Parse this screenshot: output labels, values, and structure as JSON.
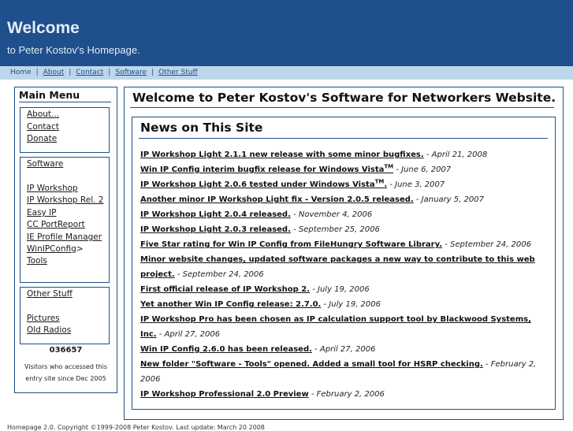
{
  "header": {
    "title": "Welcome",
    "subtitle": "to Peter Kostov's Homepage."
  },
  "nav": {
    "items": [
      "Home",
      "About",
      "Contact",
      "Software",
      "Other Stuff"
    ],
    "separator": "|"
  },
  "sidebar": {
    "title": "Main Menu",
    "group1": [
      "About...",
      "Contact",
      "Donate"
    ],
    "group2_header": "Software",
    "group2": [
      "IP Workshop",
      "IP Workshop Rel. 2",
      "Easy IP",
      "CC PortReport",
      "IE Profile Manager",
      "WinIPConfig",
      "Tools"
    ],
    "winipconfig_suffix": ">",
    "group3_header": "Other Stuff",
    "group3": [
      "Pictures",
      "Old Radios"
    ],
    "counter": "036657",
    "visitors_text": "Visitors who accessed this entry site since Dec 2005"
  },
  "main": {
    "title": "Welcome to Peter Kostov's Software for Networkers Website.",
    "news_title": "News on This Site",
    "tm": "TM",
    "news": [
      {
        "link": "IP Workshop Light 2.1.1 new release with some minor bugfixes.",
        "date": "April 21, 2008"
      },
      {
        "link": "Win IP Config interim bugfix release for Windows Vista",
        "tm": true,
        "date": "June 6, 2007"
      },
      {
        "link": "IP Workshop Light 2.0.6 tested under Windows Vista",
        "tm": true,
        "suffix": ".",
        "date": "June 3, 2007"
      },
      {
        "link": "Another minor IP Workshop Light fix - Version 2.0.5 released.",
        "date": "January 5, 2007"
      },
      {
        "link": "IP Workshop Light 2.0.4 released.",
        "date": "November 4, 2006"
      },
      {
        "link": "IP Workshop Light 2.0.3 released.",
        "date": "September 25, 2006"
      },
      {
        "link": "Five Star rating for Win IP Config from FileHungry Software Library.",
        "date": "September 24, 2006"
      },
      {
        "link": "Minor website changes, updated software packages a new way to contribute to this web project.",
        "date": "September 24, 2006"
      },
      {
        "link": "First official release of IP Workshop 2.",
        "date": "July 19, 2006"
      },
      {
        "link": "Yet another Win IP Config release: 2.7.0.",
        "date": "July 19, 2006"
      },
      {
        "link": "IP Workshop Pro has been chosen as IP calculation support tool by Blackwood Systems, Inc.",
        "date": "April 27, 2006"
      },
      {
        "link": "Win IP Config 2.6.0 has been released.",
        "date": "April 27, 2006"
      },
      {
        "link": "New folder \"Software - Tools\" opened. Added a small tool for HSRP checking.",
        "date": "February 2, 2006"
      },
      {
        "link": "IP Workshop Professional 2.0 Preview",
        "date": "February 2, 2006"
      }
    ]
  },
  "footer": {
    "text": "Homepage 2.0. Copyright ©1999-2008 Peter Kostov. Last update: March 20 2008"
  },
  "colors": {
    "header_bg": "#1f4f8c",
    "navbar_bg": "#bdd6e9",
    "border": "#1f4f8c"
  }
}
